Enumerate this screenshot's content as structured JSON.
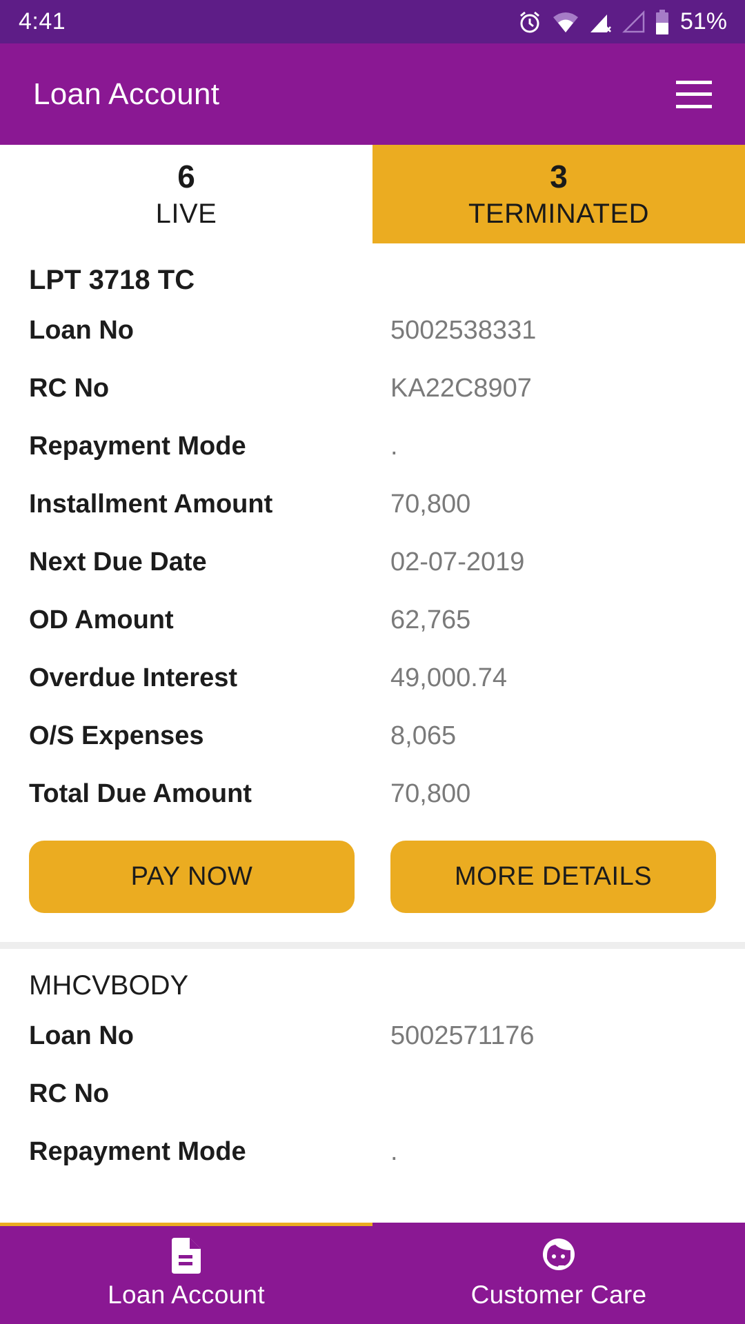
{
  "status_bar": {
    "time": "4:41",
    "battery": "51%",
    "icons": [
      "alarm-icon",
      "wifi-icon",
      "signal-no-data-icon",
      "signal-empty-icon",
      "battery-icon"
    ]
  },
  "app_bar": {
    "title": "Loan Account",
    "menu_icon": "hamburger-menu-icon"
  },
  "tabs": [
    {
      "count": "6",
      "label": "LIVE",
      "selected": false
    },
    {
      "count": "3",
      "label": "TERMINATED",
      "selected": true
    }
  ],
  "loans": [
    {
      "title": "LPT 3718 TC",
      "fields": [
        {
          "label": "Loan No",
          "value": "5002538331"
        },
        {
          "label": "RC No",
          "value": "KA22C8907"
        },
        {
          "label": "Repayment Mode",
          "value": "."
        },
        {
          "label": "Installment Amount",
          "value": "70,800"
        },
        {
          "label": "Next Due Date",
          "value": "02-07-2019"
        },
        {
          "label": "OD Amount",
          "value": "62,765"
        },
        {
          "label": "Overdue Interest",
          "value": "49,000.74"
        },
        {
          "label": "O/S Expenses",
          "value": "8,065"
        },
        {
          "label": "Total Due Amount",
          "value": "70,800"
        }
      ],
      "buttons": {
        "pay_now": "PAY NOW",
        "more_details": "MORE DETAILS"
      }
    },
    {
      "title": "MHCVBODY",
      "fields": [
        {
          "label": "Loan No",
          "value": "5002571176"
        },
        {
          "label": "RC No",
          "value": ""
        },
        {
          "label": "Repayment Mode",
          "value": "."
        }
      ]
    }
  ],
  "bottom_nav": [
    {
      "label": "Loan Account",
      "icon": "document-icon",
      "active": true
    },
    {
      "label": "Customer Care",
      "icon": "customer-support-icon",
      "active": false
    }
  ],
  "colors": {
    "status_bar": "#5e1d87",
    "primary": "#8a1893",
    "accent": "#ebac21",
    "label_text": "#1c1c1c",
    "value_text": "#7a7a7a",
    "divider": "#eeeeee"
  }
}
